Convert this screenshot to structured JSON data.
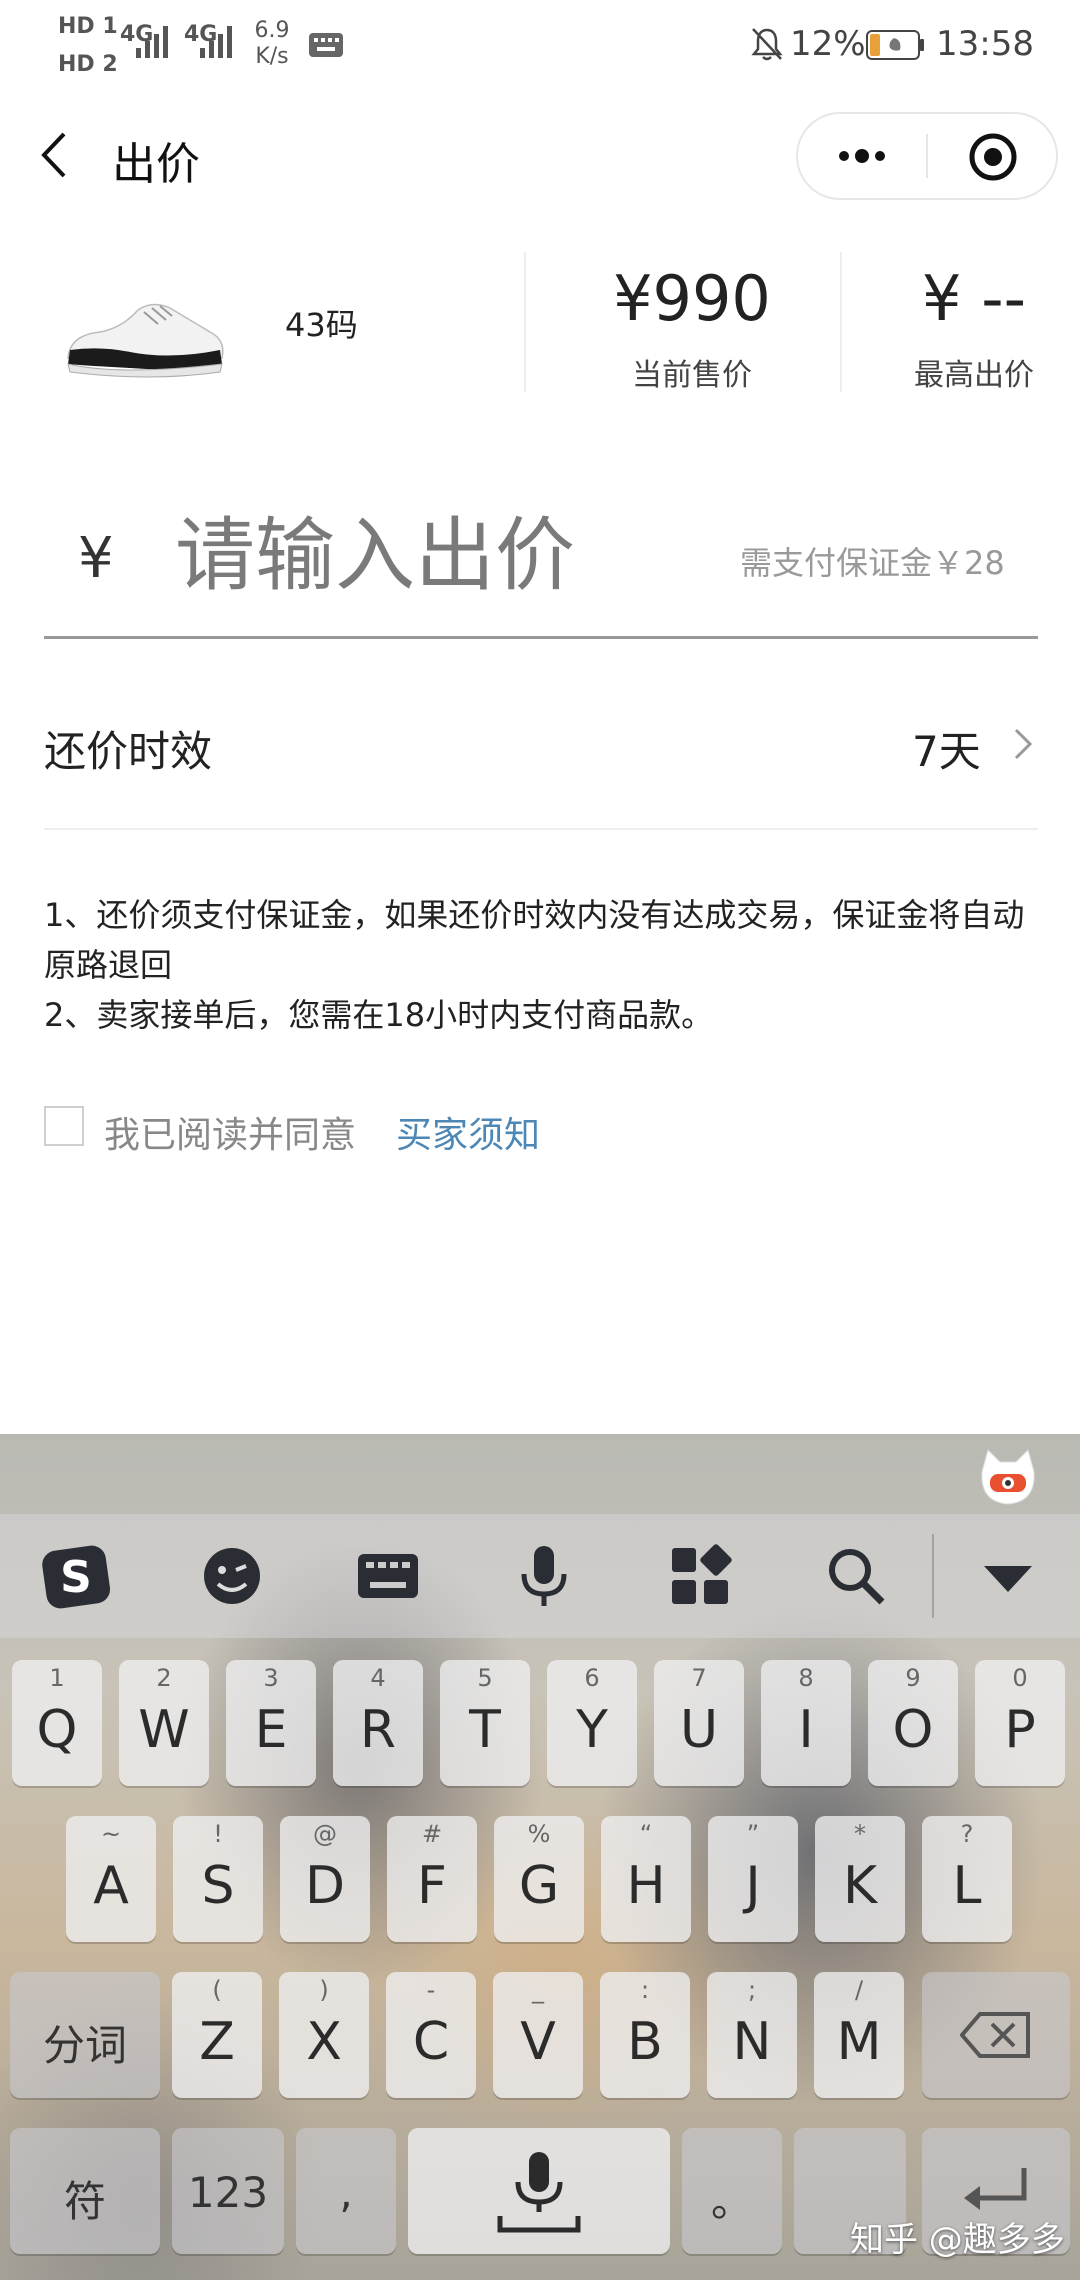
{
  "status_bar": {
    "sim1": "HD 1",
    "sim2": "HD 2",
    "net1": "4G",
    "net2": "4G",
    "speed_value": "6.9",
    "speed_unit": "K/s",
    "battery": "12%",
    "time": "13:58"
  },
  "header": {
    "title": "出价"
  },
  "product": {
    "size": "43码",
    "current_price": "¥990",
    "current_price_label": "当前售价",
    "highest_bid": "¥ --",
    "highest_bid_label": "最高出价"
  },
  "bid": {
    "currency": "¥",
    "placeholder": "请输入出价",
    "deposit_note": "需支付保证金￥28"
  },
  "validity": {
    "label": "还价时效",
    "value": "7天"
  },
  "rules": [
    "1、还价须支付保证金，如果还价时效内没有达成交易，保证金将自动原路退回",
    "2、卖家接单后，您需在18小时内支付商品款。"
  ],
  "agreement": {
    "text": "我已阅读并同意",
    "link": "买家须知",
    "checked": false
  },
  "keyboard": {
    "row1": [
      {
        "hint": "1",
        "key": "Q"
      },
      {
        "hint": "2",
        "key": "W"
      },
      {
        "hint": "3",
        "key": "E"
      },
      {
        "hint": "4",
        "key": "R"
      },
      {
        "hint": "5",
        "key": "T"
      },
      {
        "hint": "6",
        "key": "Y"
      },
      {
        "hint": "7",
        "key": "U"
      },
      {
        "hint": "8",
        "key": "I"
      },
      {
        "hint": "9",
        "key": "O"
      },
      {
        "hint": "0",
        "key": "P"
      }
    ],
    "row2": [
      {
        "hint": "~",
        "key": "A"
      },
      {
        "hint": "!",
        "key": "S"
      },
      {
        "hint": "@",
        "key": "D"
      },
      {
        "hint": "#",
        "key": "F"
      },
      {
        "hint": "%",
        "key": "G"
      },
      {
        "hint": "“",
        "key": "H"
      },
      {
        "hint": "”",
        "key": "J"
      },
      {
        "hint": "*",
        "key": "K"
      },
      {
        "hint": "?",
        "key": "L"
      }
    ],
    "row3": [
      {
        "hint": "(",
        "key": "Z"
      },
      {
        "hint": ")",
        "key": "X"
      },
      {
        "hint": "-",
        "key": "C"
      },
      {
        "hint": "_",
        "key": "V"
      },
      {
        "hint": ":",
        "key": "B"
      },
      {
        "hint": ";",
        "key": "N"
      },
      {
        "hint": "/",
        "key": "M"
      }
    ],
    "fenci": "分词",
    "fu": "符",
    "num": "123",
    "comma": ",",
    "period": "。"
  },
  "watermark": "知乎 @趣多多"
}
